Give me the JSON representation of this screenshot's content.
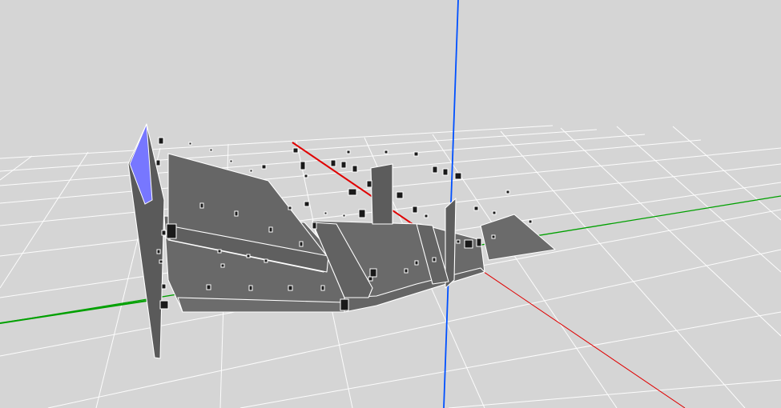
{
  "viewport": {
    "background_color": "#d5d5d5",
    "grid_color": "#ffffff",
    "floor_color": "#6a6a6a",
    "wall_color": "#666666",
    "highlight_color": "#7777ff",
    "axis_colors": {
      "x": "#e00000",
      "y": "#00a000",
      "z": "#0050ff"
    }
  }
}
